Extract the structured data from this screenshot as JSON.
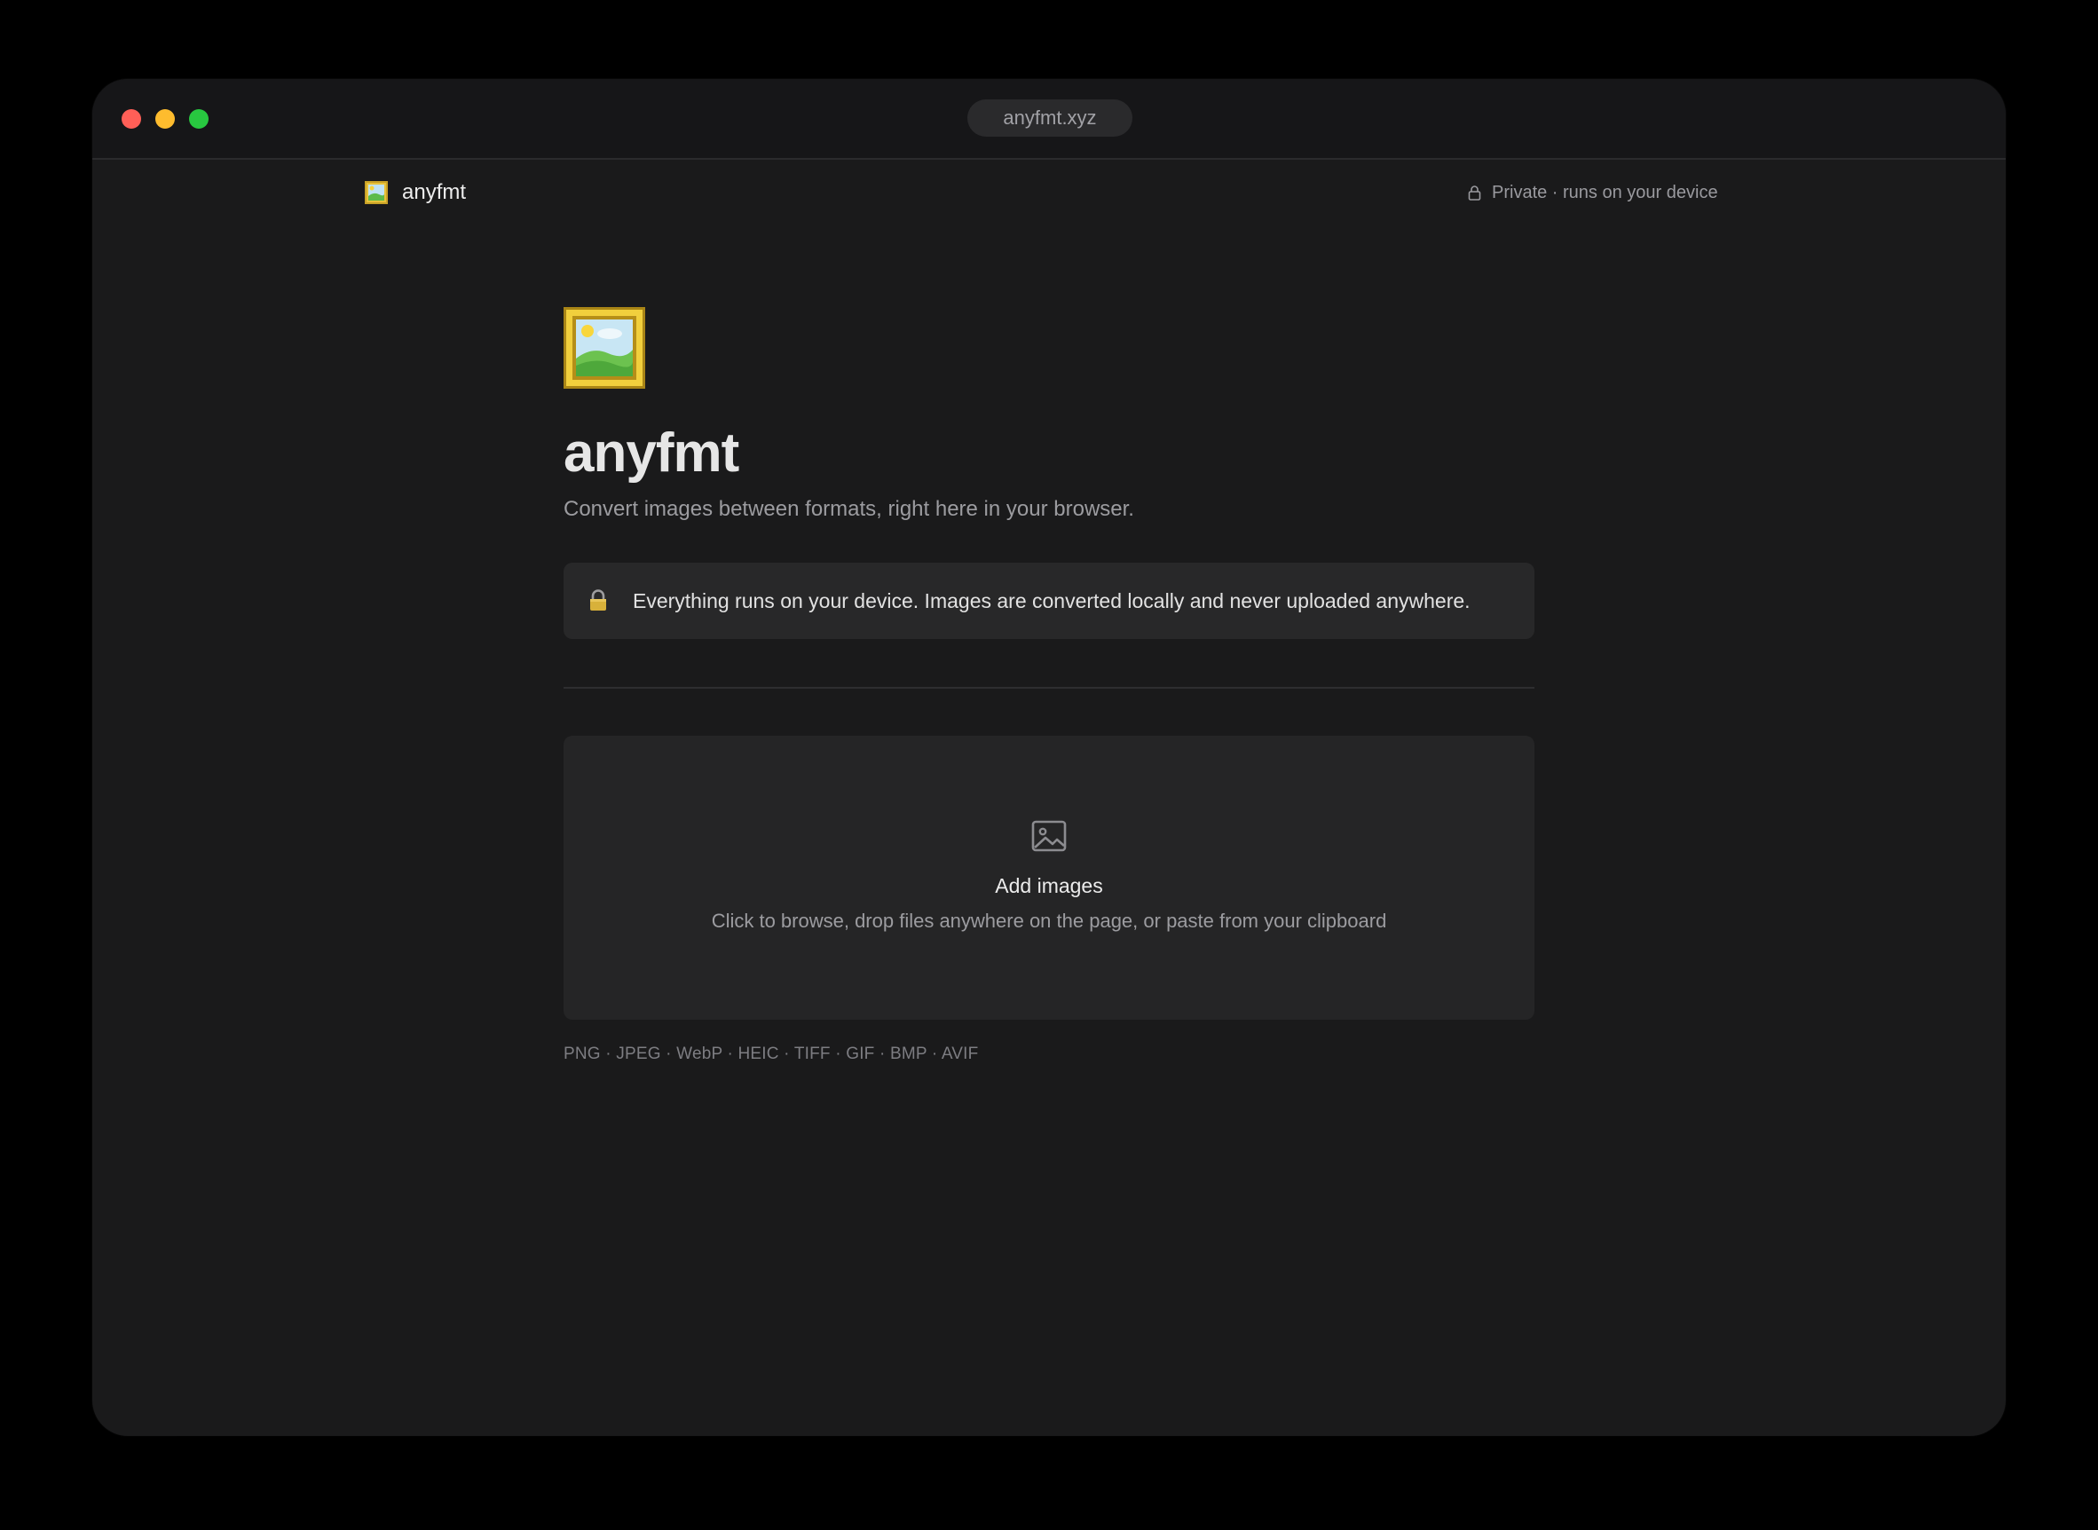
{
  "browser": {
    "url": "anyfmt.xyz"
  },
  "nav": {
    "brand_name": "anyfmt",
    "privacy_text": "Private · runs on your device",
    "brand_icon": "framed-picture-icon",
    "privacy_icon": "lock-icon"
  },
  "hero": {
    "icon": "framed-picture-icon",
    "title": "anyfmt",
    "subtitle": "Convert images between formats, right here in your browser."
  },
  "notice": {
    "icon": "lock-icon",
    "text": "Everything runs on your device. Images are converted locally and never uploaded anywhere."
  },
  "dropzone": {
    "icon": "image-icon",
    "title": "Add images",
    "subtitle": "Click to browse, drop files anywhere on the page, or paste from your clipboard"
  },
  "formats": "PNG · JPEG · WebP · HEIC · TIFF · GIF · BMP · AVIF",
  "colors": {
    "background": "#1a1a1b",
    "close": "#ff5f57",
    "minimize": "#febc2e",
    "zoom": "#28c840"
  }
}
